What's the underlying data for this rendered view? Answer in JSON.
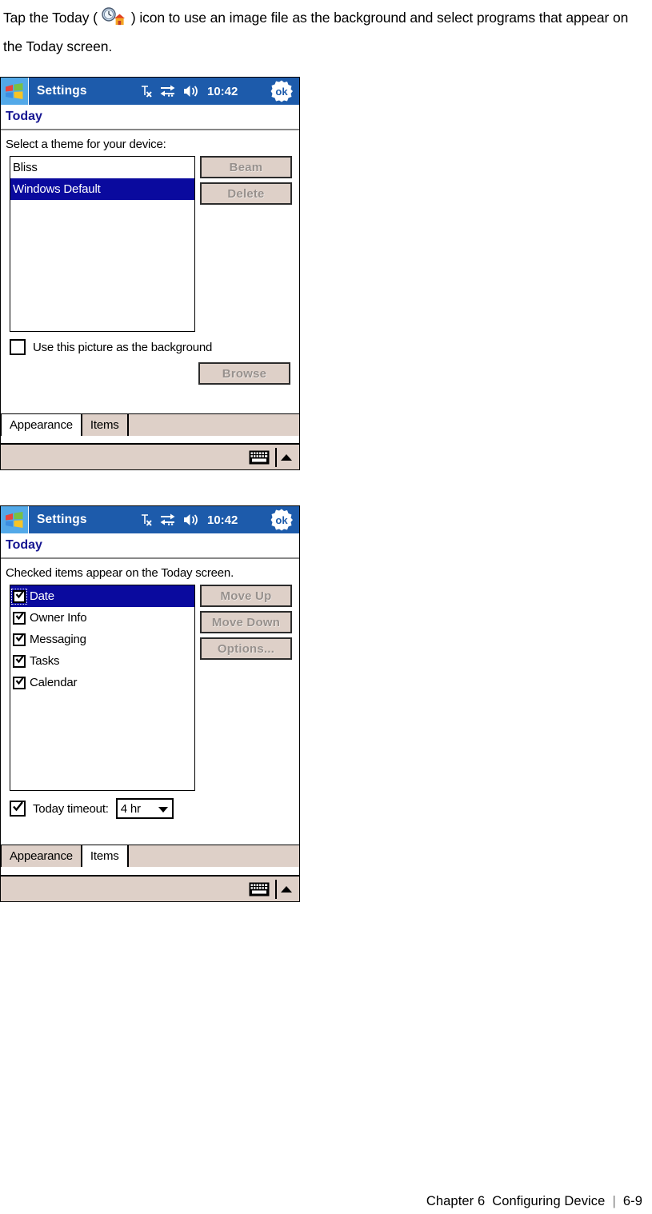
{
  "intro": {
    "text_before": "Tap the Today (",
    "icon_name": "today-clock-house-icon",
    "text_after": ") icon to use an image file as the background and select programs that appear on the Today screen."
  },
  "colors": {
    "titlebar_blue": "#1d5bab",
    "start_button_blue": "#53a9e8",
    "heading_navy": "#161692",
    "selection_navy": "#0a0a9e",
    "chrome_beige": "#ded0c8",
    "disabled_text": "#97908c"
  },
  "screenshot_appearance": {
    "titlebar": {
      "start_icon": "windows-flag-icon",
      "title": "Settings",
      "icons": [
        "no-signal-icon",
        "connectivity-icon",
        "volume-icon"
      ],
      "clock": "10:42",
      "ok_label": "ok"
    },
    "page_title": "Today",
    "prompt": "Select a theme for your device:",
    "theme_list": [
      {
        "label": "Bliss",
        "selected": false
      },
      {
        "label": "Windows Default",
        "selected": true
      }
    ],
    "buttons": [
      {
        "label": "Beam",
        "disabled": true
      },
      {
        "label": "Delete",
        "disabled": true
      }
    ],
    "checkbox": {
      "label": "Use this picture as the background",
      "checked": false
    },
    "browse_button": {
      "label": "Browse",
      "disabled": true
    },
    "tabs": [
      {
        "label": "Appearance",
        "active": true
      },
      {
        "label": "Items",
        "active": false
      }
    ],
    "sip": {
      "keyboard_icon": "keyboard-icon",
      "arrow_icon": "chevron-up-icon"
    }
  },
  "screenshot_items": {
    "titlebar": {
      "start_icon": "windows-flag-icon",
      "title": "Settings",
      "icons": [
        "no-signal-icon",
        "connectivity-icon",
        "volume-icon"
      ],
      "clock": "10:42",
      "ok_label": "ok"
    },
    "page_title": "Today",
    "prompt": "Checked items appear on the Today screen.",
    "item_list": [
      {
        "label": "Date",
        "checked": true,
        "selected": true
      },
      {
        "label": "Owner Info",
        "checked": true,
        "selected": false
      },
      {
        "label": "Messaging",
        "checked": true,
        "selected": false
      },
      {
        "label": "Tasks",
        "checked": true,
        "selected": false
      },
      {
        "label": "Calendar",
        "checked": true,
        "selected": false
      }
    ],
    "buttons": [
      {
        "label": "Move Up",
        "disabled": true
      },
      {
        "label": "Move Down",
        "disabled": true
      },
      {
        "label": "Options...",
        "disabled": true
      }
    ],
    "timeout": {
      "label": "Today timeout:",
      "checked": true,
      "value": "4 hr"
    },
    "tabs": [
      {
        "label": "Appearance",
        "active": false
      },
      {
        "label": "Items",
        "active": true
      }
    ],
    "sip": {
      "keyboard_icon": "keyboard-icon",
      "arrow_icon": "chevron-up-icon"
    }
  },
  "footer": {
    "chapter": "Chapter 6",
    "title": "Configuring Device",
    "separator": "|",
    "page": "6-9"
  }
}
